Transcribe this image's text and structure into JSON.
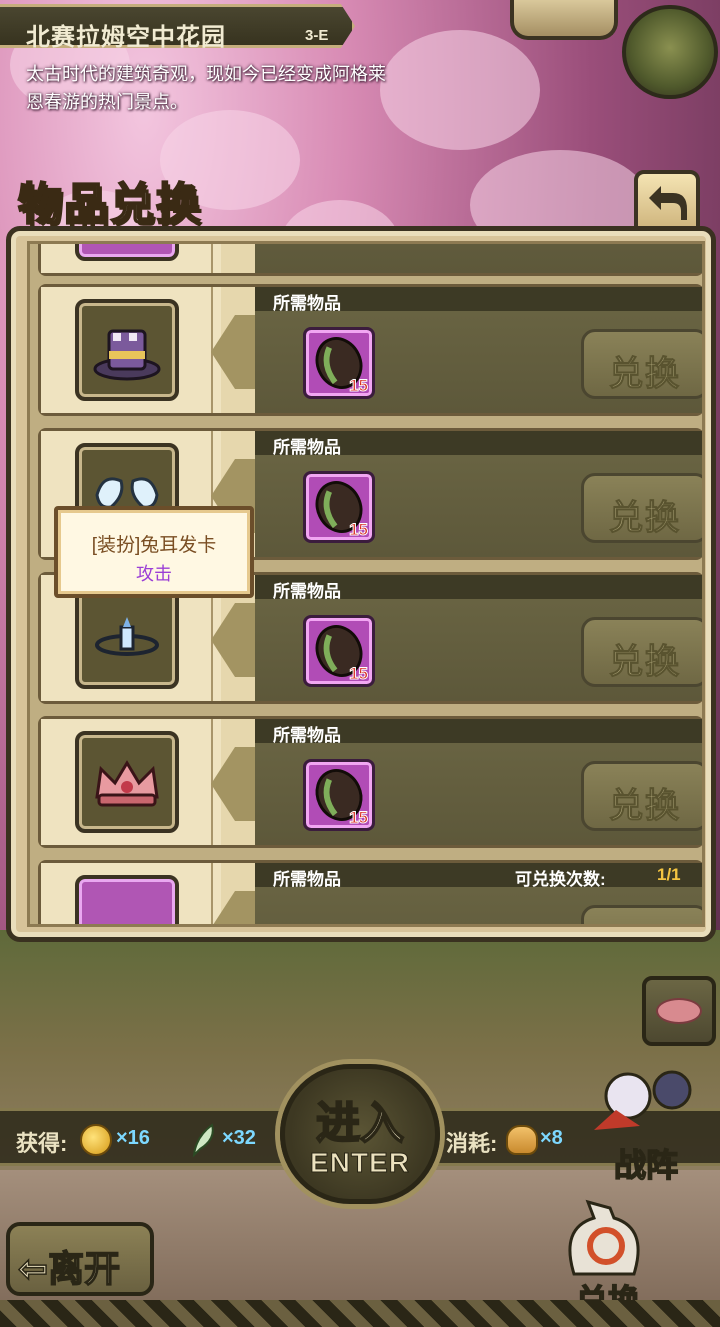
{
  "stage": {
    "title": "北赛拉姆空中花园",
    "code": "3-E",
    "description": "太古时代的建筑奇观，现如今已经变成阿格莱恩春游的热门景点。"
  },
  "panel": {
    "title": "物品兑换",
    "required_label": "所需物品",
    "exchange_label": "兑换",
    "limit_label": "可兑换次数:",
    "limit_value": "1/1"
  },
  "rows": [
    {
      "item": "top-hat-icon",
      "req_item": "seed-icon",
      "req_count": "15"
    },
    {
      "item": "bunny-ears-icon",
      "req_item": "seed-icon",
      "req_count": "15"
    },
    {
      "item": "tiara-icon",
      "req_item": "seed-icon",
      "req_count": "15"
    },
    {
      "item": "crown-icon",
      "req_item": "seed-icon",
      "req_count": "15"
    }
  ],
  "tooltip": {
    "name": "[装扮]兔耳发卡",
    "stat": "攻击"
  },
  "rewards": {
    "gain_label": "获得:",
    "coin_value": "×16",
    "feather_value": "×32",
    "cost_label": "消耗:",
    "bread_value": "×8"
  },
  "buttons": {
    "enter_main": "进入",
    "enter_sub": "ENTER",
    "team": "战阵",
    "leave": "⇦离开",
    "exchange": "兑换"
  },
  "colors": {
    "accent_gold": "#f5c542",
    "count_red": "#d8281d",
    "reward_blue": "#7dd8ff",
    "stat_purple": "#9b3fd6"
  }
}
